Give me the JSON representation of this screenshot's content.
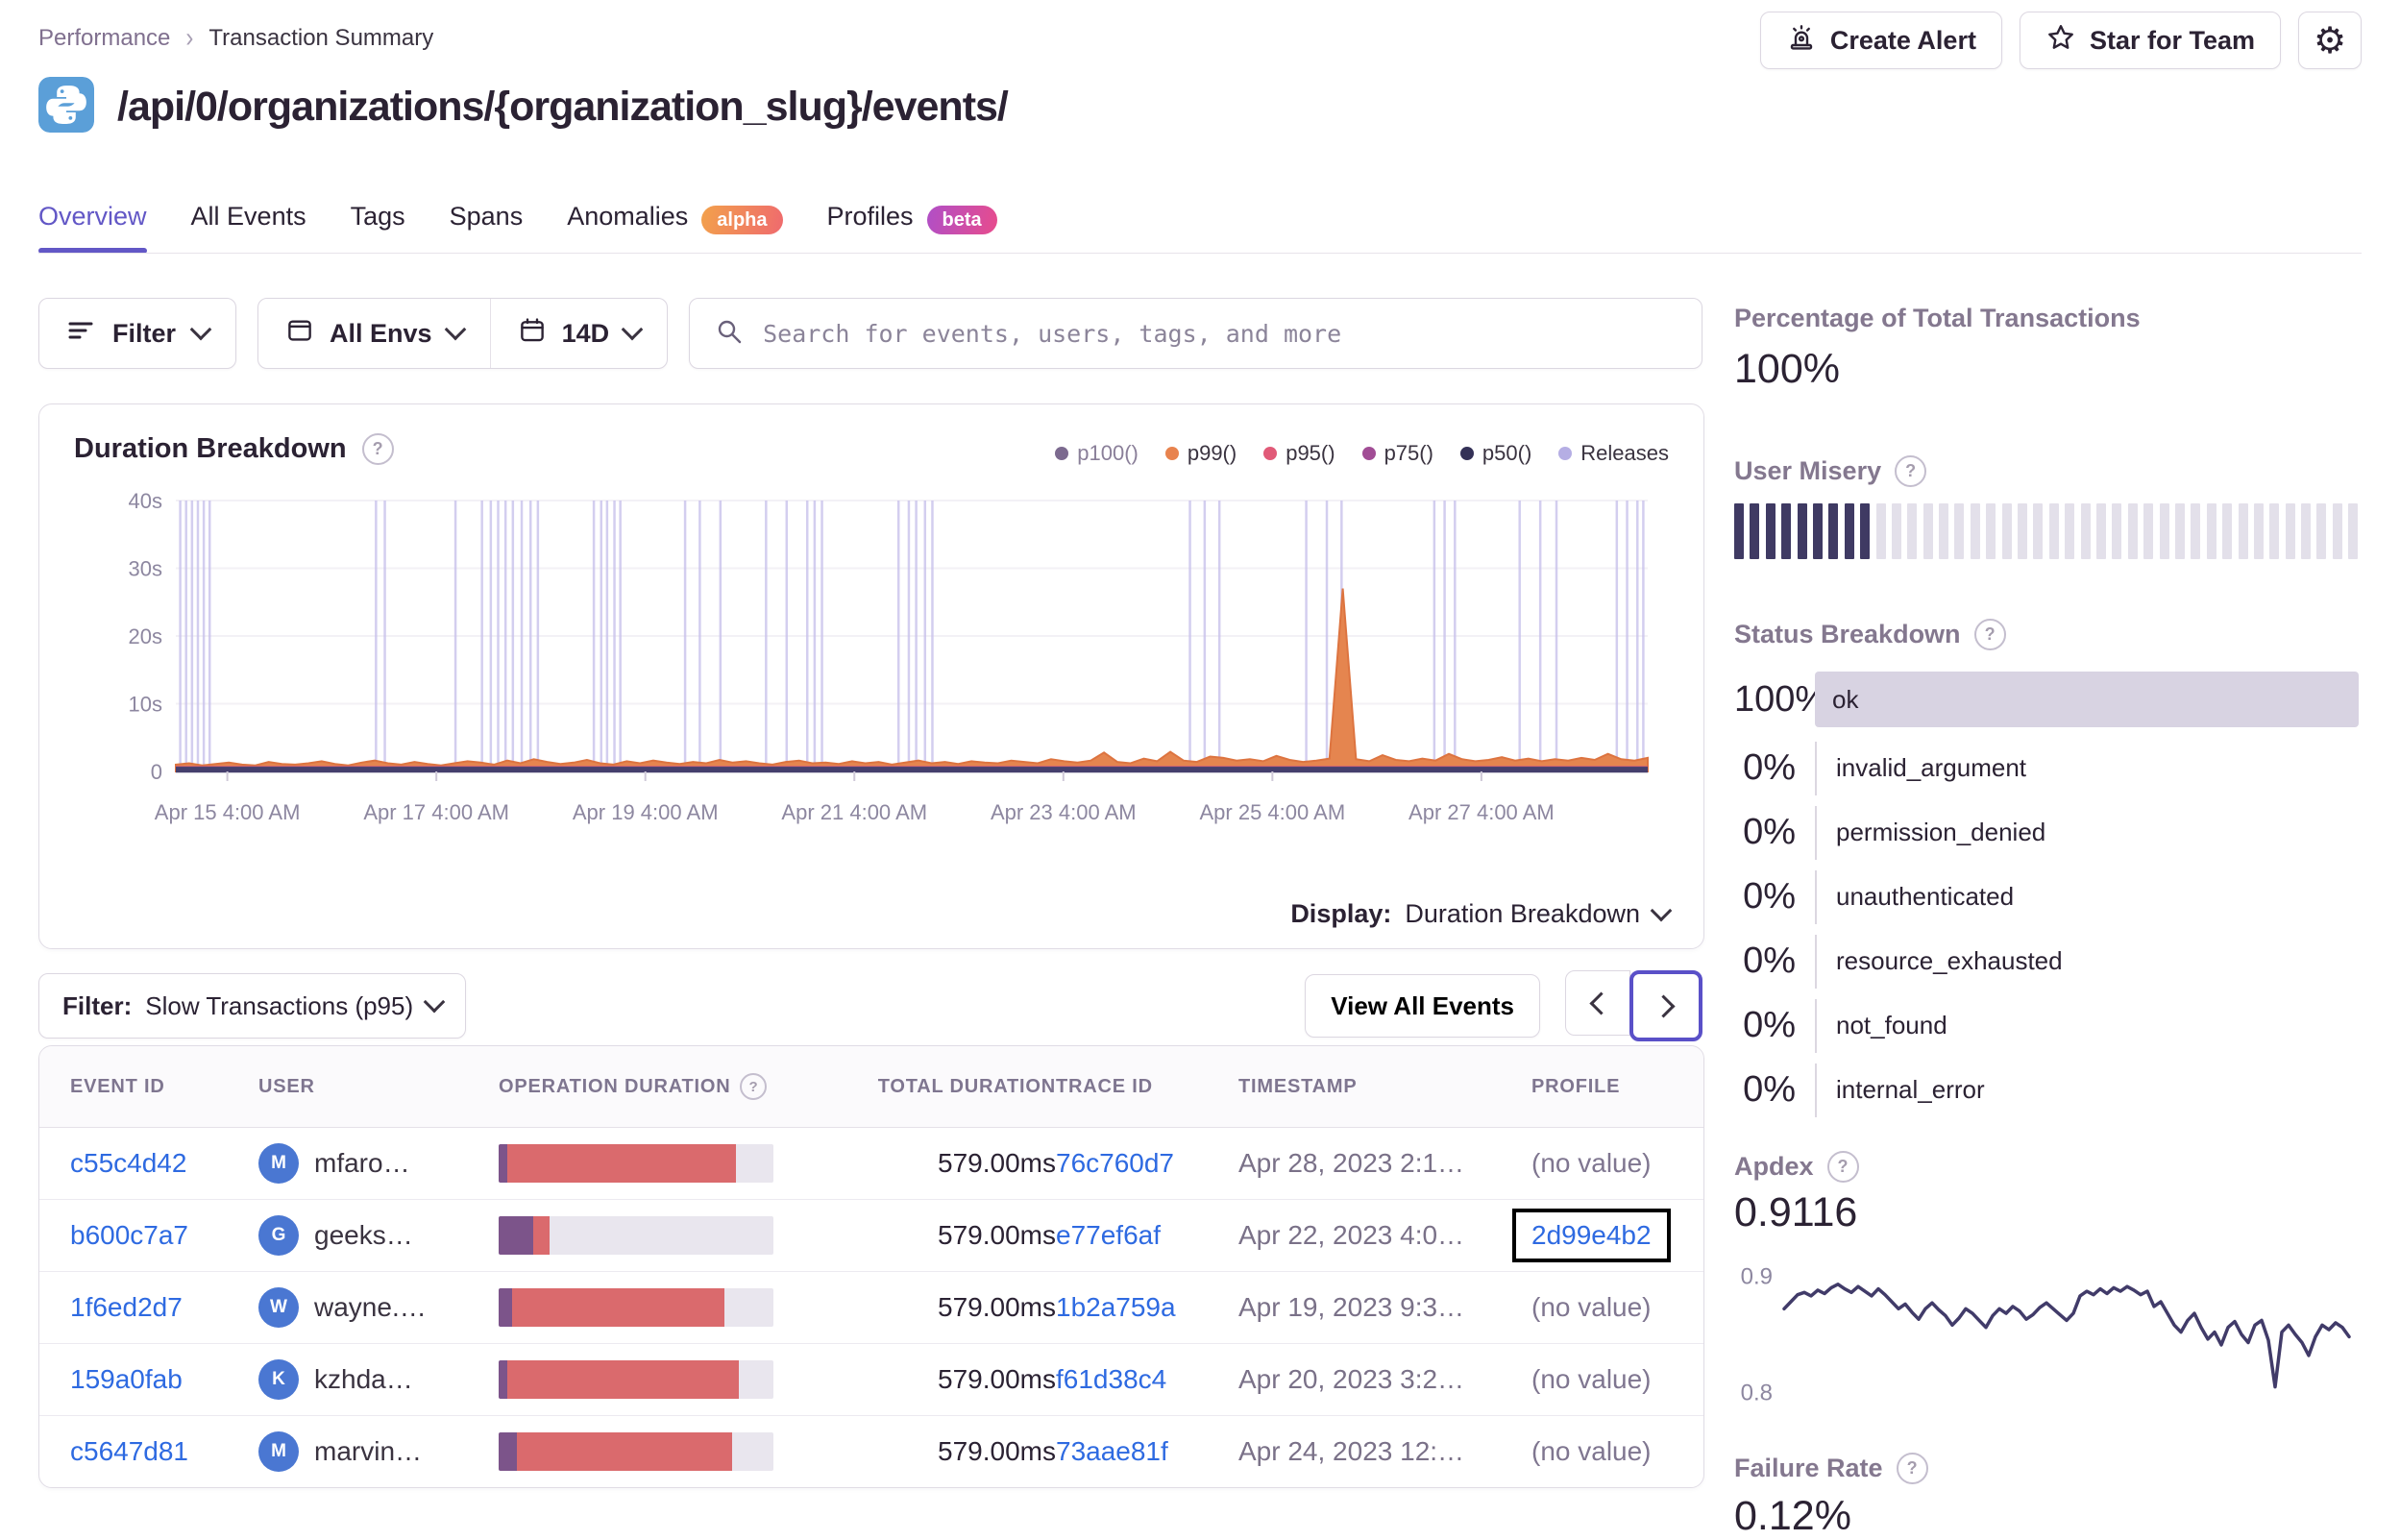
{
  "colors": {
    "accent_purple": "#6257c6",
    "link_blue": "#2e6ae1",
    "text_dark": "#2b2233",
    "text_muted": "#80708f",
    "bar_purple": "#7c548a",
    "bar_red": "#da6a6d",
    "bar_track": "#e9e6ee",
    "release_line": "#c9c2ec",
    "p99_orange": "#e5854f",
    "sparkline_navy": "#413b69",
    "ok_bar_bg": "#d8d3e2",
    "avatar_blue": "#4a77d2"
  },
  "breadcrumb": {
    "parent": "Performance",
    "current": "Transaction Summary"
  },
  "header": {
    "title": "/api/0/organizations/{organization_slug}/events/",
    "title_icon": "python-logo",
    "create_alert_label": "Create Alert",
    "star_label": "Star for Team"
  },
  "tabs": [
    {
      "label": "Overview",
      "active": true
    },
    {
      "label": "All Events"
    },
    {
      "label": "Tags"
    },
    {
      "label": "Spans"
    },
    {
      "label": "Anomalies",
      "badge": "alpha"
    },
    {
      "label": "Profiles",
      "badge": "beta"
    }
  ],
  "controls": {
    "filter_label": "Filter",
    "env_label": "All Envs",
    "date_label": "14D",
    "search_placeholder": "Search for events, users, tags, and more"
  },
  "chart_panel": {
    "title": "Duration Breakdown",
    "legend": [
      {
        "label": "p100()",
        "color": "#7c6a8f",
        "muted": true
      },
      {
        "label": "p99()",
        "color": "#e8834e"
      },
      {
        "label": "p95()",
        "color": "#e15a78"
      },
      {
        "label": "p75()",
        "color": "#a14d95"
      },
      {
        "label": "p50()",
        "color": "#343157"
      },
      {
        "label": "Releases",
        "color": "#b5aee4"
      }
    ],
    "display_label": "Display:",
    "display_value": "Duration Breakdown"
  },
  "chart_data": [
    {
      "id": "duration-breakdown",
      "type": "area",
      "title": "Duration Breakdown",
      "y_unit": "seconds",
      "ylim": [
        0,
        40
      ],
      "y_ticks": [
        {
          "v": 0,
          "label": "0"
        },
        {
          "v": 10,
          "label": "10s"
        },
        {
          "v": 20,
          "label": "20s"
        },
        {
          "v": 30,
          "label": "30s"
        },
        {
          "v": 40,
          "label": "40s"
        }
      ],
      "x_ticks": [
        {
          "percent": 3.5,
          "label": "Apr 15 4:00 AM"
        },
        {
          "percent": 17.7,
          "label": "Apr 17 4:00 AM"
        },
        {
          "percent": 31.9,
          "label": "Apr 19 4:00 AM"
        },
        {
          "percent": 46.1,
          "label": "Apr 21 4:00 AM"
        },
        {
          "percent": 60.3,
          "label": "Apr 23 4:00 AM"
        },
        {
          "percent": 74.5,
          "label": "Apr 25 4:00 AM"
        },
        {
          "percent": 88.7,
          "label": "Apr 27 4:00 AM"
        }
      ],
      "p99_series_seconds": [
        1.0,
        1.2,
        0.9,
        1.1,
        1.3,
        1.0,
        0.9,
        1.4,
        1.1,
        1.0,
        1.2,
        1.5,
        1.1,
        0.9,
        1.3,
        1.6,
        1.2,
        1.0,
        1.4,
        1.1,
        0.9,
        1.2,
        1.5,
        1.3,
        1.0,
        1.6,
        1.2,
        1.8,
        1.4,
        1.1,
        1.3,
        1.7,
        1.2,
        1.0,
        1.5,
        1.2,
        1.6,
        1.3,
        1.1,
        1.4,
        1.2,
        1.7,
        1.3,
        1.5,
        1.2,
        1.0,
        1.4,
        1.6,
        1.2,
        1.3,
        1.1,
        1.5,
        1.2,
        1.4,
        1.0,
        1.3,
        1.6,
        1.2,
        1.4,
        1.1,
        1.5,
        1.3,
        1.2,
        1.6,
        1.4,
        1.2,
        1.8,
        1.5,
        1.3,
        1.6,
        2.8,
        1.4,
        1.2,
        1.9,
        1.5,
        2.9,
        1.6,
        1.4,
        2.2,
        2.0,
        1.6,
        1.8,
        1.5,
        2.3,
        1.7,
        1.4,
        1.6,
        1.9,
        27.0,
        1.8,
        1.5,
        2.4,
        1.7,
        1.5,
        1.9,
        1.6,
        2.6,
        1.8,
        1.5,
        1.7,
        2.1,
        1.6,
        1.9,
        1.5,
        1.8,
        1.6,
        2.0,
        1.7,
        2.6,
        1.8,
        1.6,
        2.0
      ],
      "peak_seconds": 27,
      "baseline_series": [
        {
          "name": "p95()",
          "color": "#d65f79",
          "approx_seconds": 0.6
        },
        {
          "name": "p75()",
          "color": "#7d5084",
          "approx_seconds": 0.45
        },
        {
          "name": "p50()",
          "color": "#453f6d",
          "approx_seconds": 0.25
        }
      ],
      "releases_x_percent": [
        0.3,
        0.7,
        1.1,
        1.5,
        1.9,
        2.3,
        13.6,
        14.2,
        19.0,
        20.8,
        21.4,
        21.9,
        22.4,
        22.9,
        23.5,
        24.1,
        24.6,
        28.4,
        28.9,
        29.3,
        29.8,
        30.2,
        34.6,
        35.6,
        37.0,
        40.1,
        41.5,
        42.9,
        43.4,
        43.9,
        49.1,
        49.8,
        50.3,
        50.9,
        51.4,
        68.9,
        69.9,
        70.9,
        76.8,
        78.2,
        79.2,
        85.5,
        86.2,
        86.9,
        91.3,
        92.7,
        93.8,
        97.9,
        98.6,
        99.3,
        99.7
      ]
    },
    {
      "id": "apdex-trend",
      "type": "line",
      "color": "#413b69",
      "ylim": [
        0.78,
        0.92
      ],
      "y_labels": [
        {
          "v": 0.9,
          "label": "0.9"
        },
        {
          "v": 0.8,
          "label": "0.8"
        }
      ],
      "values": [
        0.872,
        0.878,
        0.884,
        0.886,
        0.883,
        0.888,
        0.885,
        0.89,
        0.893,
        0.889,
        0.886,
        0.891,
        0.887,
        0.883,
        0.889,
        0.884,
        0.878,
        0.872,
        0.876,
        0.869,
        0.863,
        0.872,
        0.877,
        0.871,
        0.866,
        0.858,
        0.864,
        0.872,
        0.868,
        0.862,
        0.856,
        0.866,
        0.872,
        0.868,
        0.874,
        0.87,
        0.863,
        0.867,
        0.873,
        0.877,
        0.872,
        0.867,
        0.862,
        0.868,
        0.883,
        0.887,
        0.884,
        0.889,
        0.885,
        0.89,
        0.887,
        0.891,
        0.888,
        0.884,
        0.887,
        0.874,
        0.878,
        0.868,
        0.858,
        0.852,
        0.862,
        0.868,
        0.856,
        0.846,
        0.852,
        0.841,
        0.856,
        0.861,
        0.85,
        0.843,
        0.858,
        0.862,
        0.845,
        0.805,
        0.852,
        0.858,
        0.85,
        0.843,
        0.832,
        0.848,
        0.858,
        0.854,
        0.86,
        0.856,
        0.848
      ]
    }
  ],
  "events_toolbar": {
    "filter_label": "Filter:",
    "filter_value": "Slow Transactions (p95)",
    "view_all_label": "View All Events"
  },
  "table": {
    "columns": [
      {
        "label": "EVENT ID"
      },
      {
        "label": "USER"
      },
      {
        "label": "OPERATION DURATION",
        "help": true
      },
      {
        "label": "TOTAL DURATION",
        "align": "right"
      },
      {
        "label": "TRACE ID"
      },
      {
        "label": "TIMESTAMP"
      },
      {
        "label": "PROFILE"
      }
    ],
    "rows": [
      {
        "event_id": "c55c4d42",
        "user": "mfaro…",
        "avatar": "M",
        "op_purple_pct": 3.2,
        "op_red_pct": 83.3,
        "total": "579.00ms",
        "trace_id": "76c760d7",
        "timestamp": "Apr 28, 2023 2:1…",
        "profile": "(no value)",
        "profile_link": false,
        "profile_focused": false
      },
      {
        "event_id": "b600c7a7",
        "user": "geeks…",
        "avatar": "G",
        "op_purple_pct": 12.6,
        "op_red_pct": 5.8,
        "total": "579.00ms",
        "trace_id": "e77ef6af",
        "timestamp": "Apr 22, 2023 4:0…",
        "profile": "2d99e4b2",
        "profile_link": true,
        "profile_focused": true
      },
      {
        "event_id": "1f6ed2d7",
        "user": "wayne.…",
        "avatar": "W",
        "op_purple_pct": 5.0,
        "op_red_pct": 77.0,
        "total": "579.00ms",
        "trace_id": "1b2a759a",
        "timestamp": "Apr 19, 2023 9:3…",
        "profile": "(no value)",
        "profile_link": false,
        "profile_focused": false
      },
      {
        "event_id": "159a0fab",
        "user": "kzhda…",
        "avatar": "K",
        "op_purple_pct": 3.2,
        "op_red_pct": 84.3,
        "total": "579.00ms",
        "trace_id": "f61d38c4",
        "timestamp": "Apr 20, 2023 3:2…",
        "profile": "(no value)",
        "profile_link": false,
        "profile_focused": false
      },
      {
        "event_id": "c5647d81",
        "user": "marvin…",
        "avatar": "M",
        "op_purple_pct": 6.7,
        "op_red_pct": 78.2,
        "total": "579.00ms",
        "trace_id": "73aae81f",
        "timestamp": "Apr 24, 2023 12:…",
        "profile": "(no value)",
        "profile_link": false,
        "profile_focused": false
      }
    ]
  },
  "sidebar": {
    "pct_total": {
      "heading": "Percentage of Total Transactions",
      "value": "100%"
    },
    "user_misery": {
      "heading": "User Misery",
      "ticks_total": 40,
      "ticks_filled": 9
    },
    "status_breakdown": {
      "heading": "Status Breakdown",
      "rows": [
        {
          "percent": "100%",
          "label": "ok",
          "bar": true
        },
        {
          "percent": "0%",
          "label": "invalid_argument",
          "bar": false
        },
        {
          "percent": "0%",
          "label": "permission_denied",
          "bar": false
        },
        {
          "percent": "0%",
          "label": "unauthenticated",
          "bar": false
        },
        {
          "percent": "0%",
          "label": "resource_exhausted",
          "bar": false
        },
        {
          "percent": "0%",
          "label": "not_found",
          "bar": false
        },
        {
          "percent": "0%",
          "label": "internal_error",
          "bar": false
        }
      ]
    },
    "apdex": {
      "heading": "Apdex",
      "value": "0.9116"
    },
    "failure_rate": {
      "heading": "Failure Rate",
      "value": "0.12%"
    }
  }
}
